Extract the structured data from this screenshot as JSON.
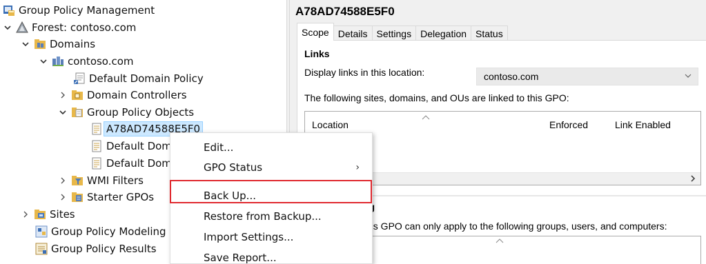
{
  "tree": {
    "root": "Group Policy Management",
    "forest": "Forest: contoso.com",
    "domains": "Domains",
    "domain": "contoso.com",
    "default_domain_policy": "Default Domain Policy",
    "domain_controllers": "Domain Controllers",
    "gpo_container": "Group Policy Objects",
    "gpo_selected": "A78AD74588E5F0",
    "gpo_default1": "Default Dom",
    "gpo_default2": "Default Dom",
    "wmi_filters": "WMI Filters",
    "starter_gpos": "Starter GPOs",
    "sites": "Sites",
    "modeling": "Group Policy Modeling",
    "results": "Group Policy Results"
  },
  "details": {
    "title": "A78AD74588E5F0",
    "tabs": [
      "Scope",
      "Details",
      "Settings",
      "Delegation",
      "Status"
    ],
    "links_heading": "Links",
    "display_links_label": "Display links in this location:",
    "display_links_value": "contoso.com",
    "linked_text": "The following sites, domains, and OUs are linked to this GPO:",
    "columns": [
      "Location",
      "Enforced",
      "Link Enabled"
    ],
    "filter_heading_partial": "ng",
    "filter_text_partial": "this GPO can only apply to the following groups, users, and computers:"
  },
  "context_menu": {
    "items": [
      "Edit...",
      "GPO Status",
      "Back Up...",
      "Restore from Backup...",
      "Import Settings...",
      "Save Report..."
    ],
    "submenu_arrow": "›",
    "highlight_color": "#e0282e"
  }
}
